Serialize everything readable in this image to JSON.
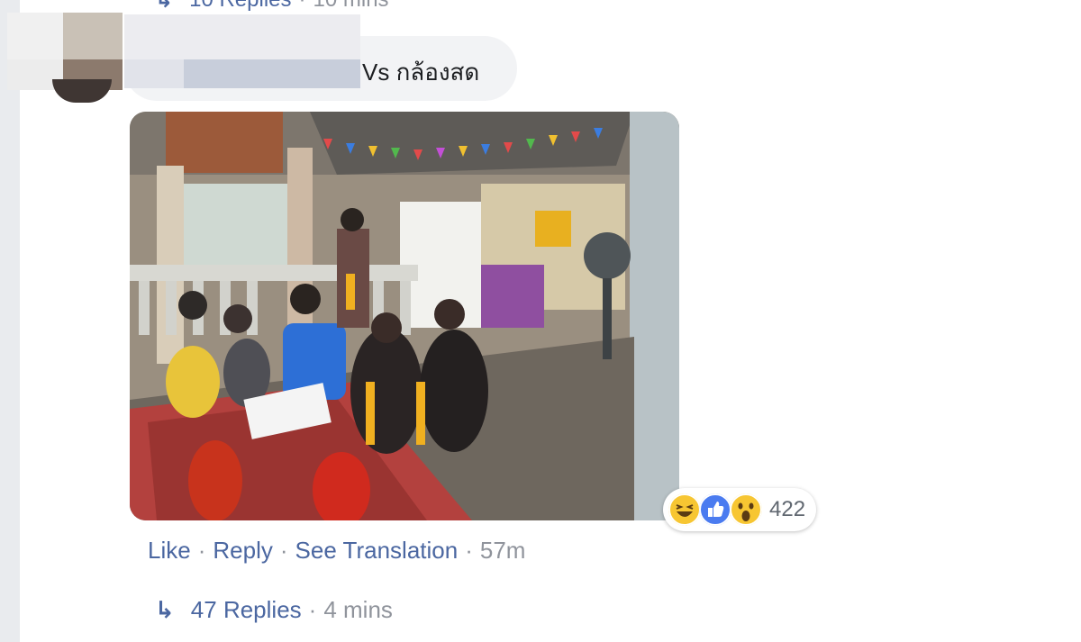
{
  "previous_thread": {
    "reply_arrow_icon": "reply-arrow-icon",
    "replies_label": "10 Replies",
    "separator": "·",
    "time": "10 mins"
  },
  "comment": {
    "text": "Vs กล้องสด",
    "photo_icon": "comment-photo",
    "reactions": {
      "icons": [
        "haha-reaction-icon",
        "like-reaction-icon",
        "wow-reaction-icon"
      ],
      "count": "422"
    },
    "actions": {
      "like": "Like",
      "reply": "Reply",
      "see_translation": "See Translation",
      "separator": "·",
      "time": "57m"
    },
    "replies": {
      "reply_arrow_icon": "reply-arrow-icon",
      "label": "47 Replies",
      "separator": "·",
      "time": "4 mins"
    }
  },
  "colors": {
    "link": "#4b67a1",
    "muted": "#90949c",
    "bubble": "#f2f3f5",
    "rail": "#e9ebee"
  }
}
